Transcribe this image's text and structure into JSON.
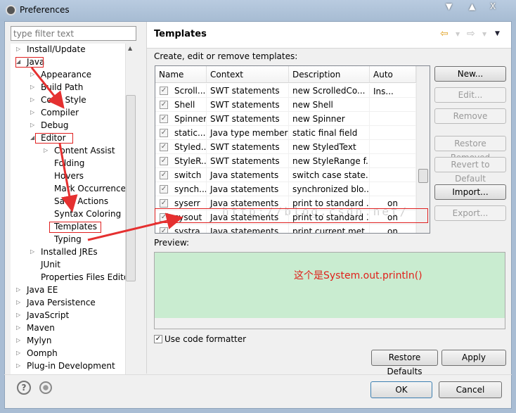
{
  "window": {
    "title": "Preferences",
    "controls": [
      "▼",
      "▲",
      "X"
    ]
  },
  "filter": {
    "placeholder": "type filter text"
  },
  "tree": [
    {
      "label": "Install/Update",
      "level": 0,
      "state": "collapsed"
    },
    {
      "label": "Java",
      "level": 0,
      "state": "expanded"
    },
    {
      "label": "Appearance",
      "level": 1,
      "state": "collapsed"
    },
    {
      "label": "Build Path",
      "level": 1,
      "state": "collapsed"
    },
    {
      "label": "Code Style",
      "level": 1,
      "state": "collapsed"
    },
    {
      "label": "Compiler",
      "level": 1,
      "state": "collapsed"
    },
    {
      "label": "Debug",
      "level": 1,
      "state": "collapsed"
    },
    {
      "label": "Editor",
      "level": 1,
      "state": "expanded"
    },
    {
      "label": "Content Assist",
      "level": 2,
      "state": "collapsed"
    },
    {
      "label": "Folding",
      "level": 2,
      "state": "leaf"
    },
    {
      "label": "Hovers",
      "level": 2,
      "state": "leaf"
    },
    {
      "label": "Mark Occurrences",
      "level": 2,
      "state": "leaf"
    },
    {
      "label": "Save Actions",
      "level": 2,
      "state": "leaf"
    },
    {
      "label": "Syntax Coloring",
      "level": 2,
      "state": "leaf"
    },
    {
      "label": "Templates",
      "level": 2,
      "state": "leaf"
    },
    {
      "label": "Typing",
      "level": 2,
      "state": "leaf"
    },
    {
      "label": "Installed JREs",
      "level": 1,
      "state": "collapsed"
    },
    {
      "label": "JUnit",
      "level": 1,
      "state": "leaf"
    },
    {
      "label": "Properties Files Editor",
      "level": 1,
      "state": "leaf"
    },
    {
      "label": "Java EE",
      "level": 0,
      "state": "collapsed"
    },
    {
      "label": "Java Persistence",
      "level": 0,
      "state": "collapsed"
    },
    {
      "label": "JavaScript",
      "level": 0,
      "state": "collapsed"
    },
    {
      "label": "Maven",
      "level": 0,
      "state": "collapsed"
    },
    {
      "label": "Mylyn",
      "level": 0,
      "state": "collapsed"
    },
    {
      "label": "Oomph",
      "level": 0,
      "state": "collapsed"
    },
    {
      "label": "Plug-in Development",
      "level": 0,
      "state": "collapsed"
    }
  ],
  "page": {
    "title": "Templates",
    "description": "Create, edit or remove templates:"
  },
  "table": {
    "columns": [
      "Name",
      "Context",
      "Description",
      "Auto Ins..."
    ],
    "rows": [
      [
        "Scroll...",
        "SWT statements",
        "new ScrolledCo...",
        ""
      ],
      [
        "Shell",
        "SWT statements",
        "new Shell",
        ""
      ],
      [
        "Spinner",
        "SWT statements",
        "new Spinner",
        ""
      ],
      [
        "static...",
        "Java type members",
        "static final field",
        ""
      ],
      [
        "Styled...",
        "SWT statements",
        "new StyledText",
        ""
      ],
      [
        "StyleR...",
        "SWT statements",
        "new StyleRange f...",
        ""
      ],
      [
        "switch",
        "Java statements",
        "switch case state...",
        ""
      ],
      [
        "synch...",
        "Java statements",
        "synchronized blo...",
        ""
      ],
      [
        "syserr",
        "Java statements",
        "print to standard ...",
        "on"
      ],
      [
        "sysout",
        "Java statements",
        "print to standard ...",
        "on"
      ],
      [
        "systra",
        "Java statements",
        "print current met...",
        "on"
      ]
    ],
    "watermark": "http://blog.csdn.net/"
  },
  "buttons": {
    "new": "New...",
    "edit": "Edit...",
    "remove": "Remove",
    "restore_removed": "Restore Removed",
    "revert": "Revert to Default",
    "import": "Import...",
    "export": "Export...",
    "restore_defaults": "Restore Defaults",
    "apply": "Apply",
    "ok": "OK",
    "cancel": "Cancel"
  },
  "preview": {
    "label": "Preview:",
    "annotation": "这个是System.out.println()"
  },
  "formatter": {
    "label": "Use code formatter",
    "checked": true
  },
  "colors": {
    "preview_bg": "#c9ecd0",
    "annotation": "#e0201a"
  }
}
